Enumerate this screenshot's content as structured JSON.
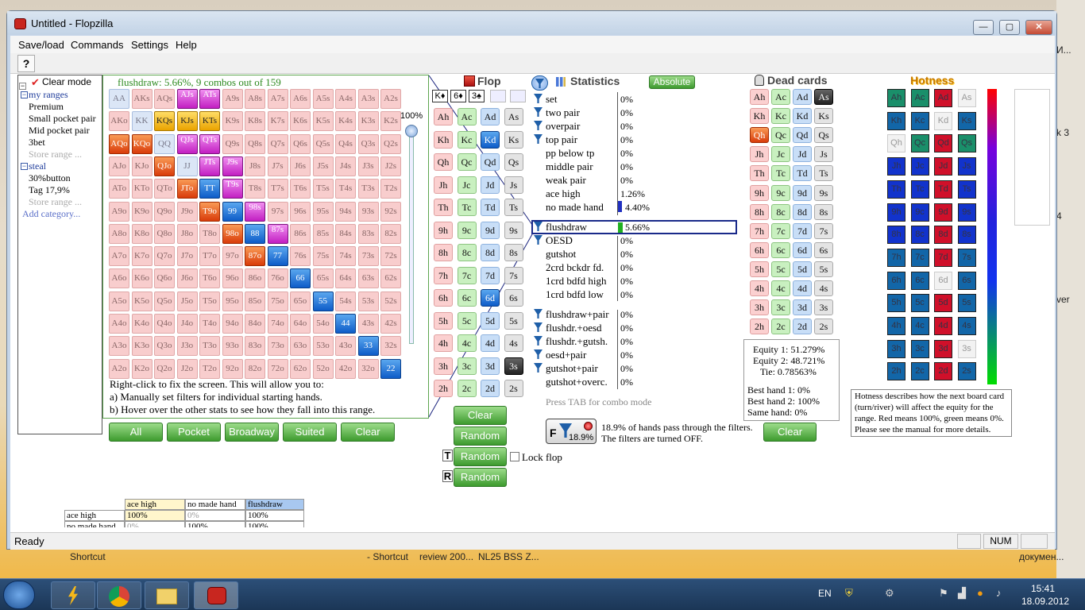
{
  "window": {
    "title": "Untitled - Flopzilla",
    "min": "—",
    "max": "▢",
    "close": "✕"
  },
  "menu": [
    "Save/load",
    "Commands",
    "Settings",
    "Help"
  ],
  "toolbar": {
    "help": "?"
  },
  "tree": {
    "clear_mode": "Clear mode",
    "cat1": "my ranges",
    "cat1_items": [
      "Premium",
      "Small pocket pair",
      "Mid pocket pair",
      "3bet",
      "Store range ..."
    ],
    "cat2": "steal",
    "cat2_items": [
      "30%button",
      "Tag 17,9%",
      "Store range ..."
    ],
    "add": "Add category..."
  },
  "grid": {
    "header": "flushdraw: 5.66%, 9 combos out of 159",
    "pct": "100%",
    "help": [
      "Right-click to fix the screen. This will allow you to:",
      "a) Manually set filters for individual starting hands.",
      "b) Hover over the other stats to see how they fall into this range."
    ],
    "rows": [
      [
        "AA",
        "AKs",
        "AQs",
        "AJs",
        "ATs",
        "A9s",
        "A8s",
        "A7s",
        "A6s",
        "A5s",
        "A4s",
        "A3s",
        "A2s"
      ],
      [
        "AKo",
        "KK",
        "KQs",
        "KJs",
        "KTs",
        "K9s",
        "K8s",
        "K7s",
        "K6s",
        "K5s",
        "K4s",
        "K3s",
        "K2s"
      ],
      [
        "AQo",
        "KQo",
        "QQ",
        "QJs",
        "QTs",
        "Q9s",
        "Q8s",
        "Q7s",
        "Q6s",
        "Q5s",
        "Q4s",
        "Q3s",
        "Q2s"
      ],
      [
        "AJo",
        "KJo",
        "QJo",
        "JJ",
        "JTs",
        "J9s",
        "J8s",
        "J7s",
        "J6s",
        "J5s",
        "J4s",
        "J3s",
        "J2s"
      ],
      [
        "ATo",
        "KTo",
        "QTo",
        "JTo",
        "TT",
        "T9s",
        "T8s",
        "T7s",
        "T6s",
        "T5s",
        "T4s",
        "T3s",
        "T2s"
      ],
      [
        "A9o",
        "K9o",
        "Q9o",
        "J9o",
        "T9o",
        "99",
        "98s",
        "97s",
        "96s",
        "95s",
        "94s",
        "93s",
        "92s"
      ],
      [
        "A8o",
        "K8o",
        "Q8o",
        "J8o",
        "T8o",
        "98o",
        "88",
        "87s",
        "86s",
        "85s",
        "84s",
        "83s",
        "82s"
      ],
      [
        "A7o",
        "K7o",
        "Q7o",
        "J7o",
        "T7o",
        "97o",
        "87o",
        "77",
        "76s",
        "75s",
        "74s",
        "73s",
        "72s"
      ],
      [
        "A6o",
        "K6o",
        "Q6o",
        "J6o",
        "T6o",
        "96o",
        "86o",
        "76o",
        "66",
        "65s",
        "64s",
        "63s",
        "62s"
      ],
      [
        "A5o",
        "K5o",
        "Q5o",
        "J5o",
        "T5o",
        "95o",
        "85o",
        "75o",
        "65o",
        "55",
        "54s",
        "53s",
        "52s"
      ],
      [
        "A4o",
        "K4o",
        "Q4o",
        "J4o",
        "T4o",
        "94o",
        "84o",
        "74o",
        "64o",
        "54o",
        "44",
        "43s",
        "42s"
      ],
      [
        "A3o",
        "K3o",
        "Q3o",
        "J3o",
        "T3o",
        "93o",
        "83o",
        "73o",
        "63o",
        "53o",
        "43o",
        "33",
        "32s"
      ],
      [
        "A2o",
        "K2o",
        "Q2o",
        "J2o",
        "T2o",
        "92o",
        "82o",
        "72o",
        "62o",
        "52o",
        "42o",
        "32o",
        "22"
      ]
    ]
  },
  "grid_buttons": [
    "All",
    "Pocket",
    "Broadway",
    "Suited",
    "Clear"
  ],
  "flop": {
    "title": "Flop",
    "board": [
      "K♦",
      "6♦",
      "3♠"
    ],
    "rows": [
      [
        "Ah",
        "Ac",
        "Ad",
        "As"
      ],
      [
        "Kh",
        "Kc",
        "Kd",
        "Ks"
      ],
      [
        "Qh",
        "Qc",
        "Qd",
        "Qs"
      ],
      [
        "Jh",
        "Jc",
        "Jd",
        "Js"
      ],
      [
        "Th",
        "Tc",
        "Td",
        "Ts"
      ],
      [
        "9h",
        "9c",
        "9d",
        "9s"
      ],
      [
        "8h",
        "8c",
        "8d",
        "8s"
      ],
      [
        "7h",
        "7c",
        "7d",
        "7s"
      ],
      [
        "6h",
        "6c",
        "6d",
        "6s"
      ],
      [
        "5h",
        "5c",
        "5d",
        "5s"
      ],
      [
        "4h",
        "4c",
        "4d",
        "4s"
      ],
      [
        "3h",
        "3c",
        "3d",
        "3s"
      ],
      [
        "2h",
        "2c",
        "2d",
        "2s"
      ]
    ],
    "clear": "Clear",
    "random": "Random",
    "turn_label": "T",
    "river_label": "R",
    "lock": "Lock flop"
  },
  "stats": {
    "title": "Statistics",
    "absolute": "Absolute",
    "g1": [
      [
        "set",
        "0%"
      ],
      [
        "two pair",
        "0%"
      ],
      [
        "overpair",
        "0%"
      ],
      [
        "top pair",
        "0%"
      ],
      [
        "pp below tp",
        "0%"
      ],
      [
        "middle pair",
        "0%"
      ],
      [
        "weak pair",
        "0%"
      ],
      [
        "ace high",
        "1.26%"
      ],
      [
        "no made hand",
        "4.40%"
      ]
    ],
    "g2": [
      [
        "flushdraw",
        "5.66%"
      ],
      [
        "OESD",
        "0%"
      ],
      [
        "gutshot",
        "0%"
      ],
      [
        "2crd bckdr fd.",
        "0%"
      ],
      [
        "1crd bdfd high",
        "0%"
      ],
      [
        "1crd bdfd low",
        "0%"
      ]
    ],
    "g3": [
      [
        "flushdraw+pair",
        "0%"
      ],
      [
        "flushdr.+oesd",
        "0%"
      ],
      [
        "flushdr.+gutsh.",
        "0%"
      ],
      [
        "oesd+pair",
        "0%"
      ],
      [
        "gutshot+pair",
        "0%"
      ],
      [
        "gutshot+overc.",
        "0%"
      ]
    ],
    "tab_hint": "Press TAB for combo mode",
    "filter_pct": "18.9%",
    "filter_text": [
      "18.9% of hands pass through the filters.",
      "The filters are turned OFF."
    ],
    "filter_letter": "F"
  },
  "dead": {
    "title": "Dead cards",
    "rows": [
      [
        "Ah",
        "Ac",
        "Ad",
        "As"
      ],
      [
        "Kh",
        "Kc",
        "Kd",
        "Ks"
      ],
      [
        "Qh",
        "Qc",
        "Qd",
        "Qs"
      ],
      [
        "Jh",
        "Jc",
        "Jd",
        "Js"
      ],
      [
        "Th",
        "Tc",
        "Td",
        "Ts"
      ],
      [
        "9h",
        "9c",
        "9d",
        "9s"
      ],
      [
        "8h",
        "8c",
        "8d",
        "8s"
      ],
      [
        "7h",
        "7c",
        "7d",
        "7s"
      ],
      [
        "6h",
        "6c",
        "6d",
        "6s"
      ],
      [
        "5h",
        "5c",
        "5d",
        "5s"
      ],
      [
        "4h",
        "4c",
        "4d",
        "4s"
      ],
      [
        "3h",
        "3c",
        "3d",
        "3s"
      ],
      [
        "2h",
        "2c",
        "2d",
        "2s"
      ]
    ],
    "equity": [
      "Equity 1: 51.279%",
      "Equity 2: 48.721%",
      "Tie: 0.78563%"
    ],
    "best": [
      "Best hand 1: 0%",
      "Best hand 2: 100%",
      "Same hand: 0%"
    ],
    "clear": "Clear"
  },
  "hot": {
    "title": "Hotness",
    "desc": [
      "Hotness describes how the next board card",
      "(turn/river) will affect the equity for the",
      "range. Red means 100%, green means 0%.",
      "Please see the manual for more details."
    ],
    "cards": [
      [
        "Ah",
        "Ac",
        "Ad",
        "As"
      ],
      [
        "Kh",
        "Kc",
        "Kd",
        "Ks"
      ],
      [
        "Qh",
        "Qc",
        "Qd",
        "Qs"
      ],
      [
        "Jh",
        "Jc",
        "Jd",
        "Js"
      ],
      [
        "Th",
        "Tc",
        "Td",
        "Ts"
      ],
      [
        "9h",
        "9c",
        "9d",
        "9s"
      ],
      [
        "8h",
        "8c",
        "8d",
        "8s"
      ],
      [
        "7h",
        "7c",
        "7d",
        "7s"
      ],
      [
        "6h",
        "6c",
        "6d",
        "6s"
      ],
      [
        "5h",
        "5c",
        "5d",
        "5s"
      ],
      [
        "4h",
        "4c",
        "4d",
        "4s"
      ],
      [
        "3h",
        "3c",
        "3d",
        "3s"
      ],
      [
        "2h",
        "2c",
        "2d",
        "2s"
      ]
    ]
  },
  "mini": {
    "cols": [
      "ace high",
      "no made hand",
      "flushdraw"
    ],
    "r1": [
      "ace high",
      "100%",
      "0%",
      "100%"
    ],
    "r2": [
      "no made hand",
      "0%",
      "100%",
      "100%"
    ]
  },
  "status": {
    "ready": "Ready",
    "num": "NUM"
  },
  "desktop": {
    "sc1": "Shortcut",
    "sc2": "- Shortcut",
    "sc3": "review 200...",
    "sc4": "NL25 BSS Z...",
    "sc5": "докумен...",
    "r1": "И...",
    "r2": "k 3",
    "r3": "4",
    "r4": "ver"
  },
  "tray": {
    "lang": "EN",
    "time": "15:41",
    "date": "18.09.2012"
  }
}
